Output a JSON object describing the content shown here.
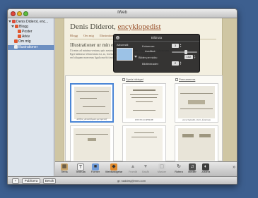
{
  "window": {
    "title": "iWeb"
  },
  "sidebar": {
    "items": [
      {
        "label": "Denis Diderot, enc...",
        "level": 0,
        "icon": "site-icon",
        "selected": false
      },
      {
        "label": "Blogg",
        "level": 1,
        "icon": "blog-icon",
        "selected": false
      },
      {
        "label": "Poster",
        "level": 2,
        "icon": "page-icon",
        "selected": false
      },
      {
        "label": "Arkiv",
        "level": 2,
        "icon": "page-icon",
        "selected": false
      },
      {
        "label": "Om mig",
        "level": 1,
        "icon": "page-icon",
        "selected": false
      },
      {
        "label": "Illustrationer",
        "level": 1,
        "icon": "page-icon",
        "selected": true
      }
    ]
  },
  "page": {
    "title_plain": "Denis Diderot, ",
    "title_link": "encyklopedist",
    "nav": [
      "Blogg",
      "Om mig",
      "Illustrationer"
    ],
    "heading": "Illustrationer ur min en",
    "intro_lines": [
      "Ut enim ad minima veniam, quis nostrum exercitationem ullam corporis suscipit laboriosam.",
      "Eget habitasse elementum est, ac, lorem dapibus commodo tortor tempor dolor.",
      "sed aliquam maecenas ligula morbi tincidunt tempus, ut maximus."
    ]
  },
  "gallery": {
    "link_left": "Spela bildspel",
    "link_right": "Prenumerera",
    "photos": [
      {
        "caption": "delfini_dessinfigure-perspectif",
        "selected": true
      },
      {
        "caption": "ENCYCLOPEDIE",
        "selected": false
      },
      {
        "caption": "encyclopedie_livre_fontenay",
        "selected": false
      },
      {
        "caption": "",
        "selected": false
      },
      {
        "caption": "",
        "selected": false
      },
      {
        "caption": "",
        "selected": false
      }
    ]
  },
  "hud": {
    "title": "Bildruta",
    "album_label": "Albumstil:",
    "columns_label": "Kolumner:",
    "columns_value": "3",
    "spacing_label": "Avstånd:",
    "per_page_label": "Bilder per sida:",
    "per_page_value": "102",
    "caption_label": "Bildtextrader:",
    "caption_value": "2",
    "spacing_level": 0.55
  },
  "toolbar": {
    "buttons": [
      {
        "label": "Tema",
        "icon": "theme-icon",
        "enabled": true
      },
      {
        "label": "Textruta",
        "icon": "textbox-icon",
        "enabled": true
      },
      {
        "label": "Former",
        "icon": "shapes-icon",
        "enabled": true
      },
      {
        "label": "Webbwidgetar",
        "icon": "widgets-icon",
        "enabled": true
      },
      {
        "label": "Framåt",
        "icon": "forward-icon",
        "enabled": false
      },
      {
        "label": "Bakåt",
        "icon": "backward-icon",
        "enabled": false
      },
      {
        "label": "Masker",
        "icon": "mask-icon",
        "enabled": false
      },
      {
        "label": "Rotera",
        "icon": "rotate-icon",
        "enabled": true
      },
      {
        "label": "Medier",
        "icon": "media-icon",
        "enabled": true
      },
      {
        "label": "Justera",
        "icon": "adjust-icon",
        "enabled": true
      }
    ]
  },
  "bottombar": {
    "add_label": "+",
    "publish_label": "Publicera",
    "visit_label": "Besök",
    "url": "gt; naddesj@mnn.com"
  },
  "colors": {
    "desktop": "#3d5f8f",
    "accent": "#4b86d6",
    "link": "#9b5530"
  }
}
